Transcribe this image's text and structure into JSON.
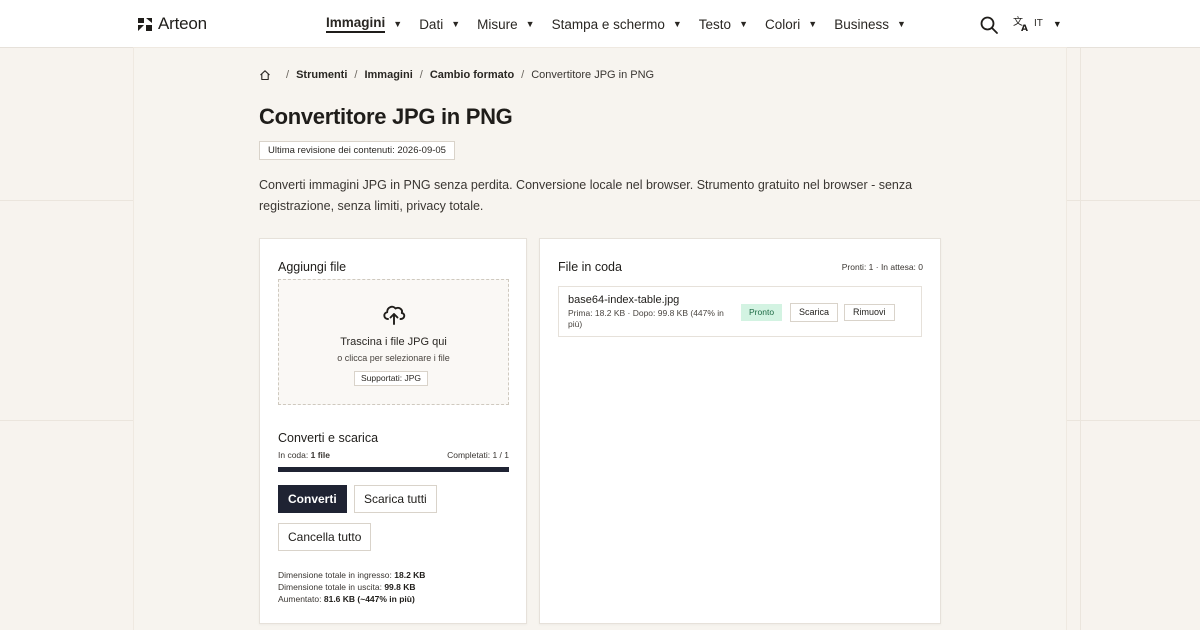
{
  "header": {
    "brand": "Arteon",
    "nav": [
      {
        "label": "Immagini",
        "active": true
      },
      {
        "label": "Dati"
      },
      {
        "label": "Misure"
      },
      {
        "label": "Stampa e schermo"
      },
      {
        "label": "Testo"
      },
      {
        "label": "Colori"
      },
      {
        "label": "Business"
      }
    ],
    "language": "IT",
    "icons": {
      "search": "search-icon",
      "translate": "translate-icon",
      "caret": "chevron-down-icon"
    }
  },
  "breadcrumb": {
    "items": [
      "Strumenti",
      "Immagini",
      "Cambio formato"
    ],
    "current": "Convertitore JPG in PNG"
  },
  "page": {
    "title": "Convertitore JPG in PNG",
    "revision": "Ultima revisione dei contenuti: 2026-09-05",
    "description": "Converti immagini JPG in PNG senza perdita. Conversione locale nel browser. Strumento gratuito nel browser - senza registrazione, senza limiti, privacy totale."
  },
  "add_files": {
    "title": "Aggiungi file",
    "dropzone_main": "Trascina i file JPG qui",
    "dropzone_sub": "o clicca per selezionare i file",
    "supported": "Supportati: JPG"
  },
  "convert": {
    "title": "Converti e scarica",
    "queued_label": "In coda:",
    "queued_value": "1 file",
    "completed": "Completati: 1 / 1",
    "progress": 1.0,
    "buttons": {
      "convert": "Converti",
      "download_all": "Scarica tutti",
      "clear_all": "Cancella tutto"
    },
    "totals": {
      "input_label": "Dimensione totale in ingresso:",
      "input_value": "18.2 KB",
      "output_label": "Dimensione totale in uscita:",
      "output_value": "99.8 KB",
      "increase_label": "Aumentato:",
      "increase_value": "81.6 KB (~447% in più)"
    }
  },
  "queue": {
    "title": "File in coda",
    "count": "Pronti: 1 · In attesa: 0",
    "files": [
      {
        "name": "base64-index-table.jpg",
        "meta": "Prima: 18.2 KB · Dopo: 99.8 KB (447% in più)",
        "status": "Pronto",
        "download": "Scarica",
        "remove": "Rimuovi"
      }
    ]
  },
  "colors": {
    "accent": "#1f2333",
    "ready_bg": "#d3f3e2",
    "ready_text": "#1d6b45",
    "page_bg": "#f7f3ee"
  }
}
